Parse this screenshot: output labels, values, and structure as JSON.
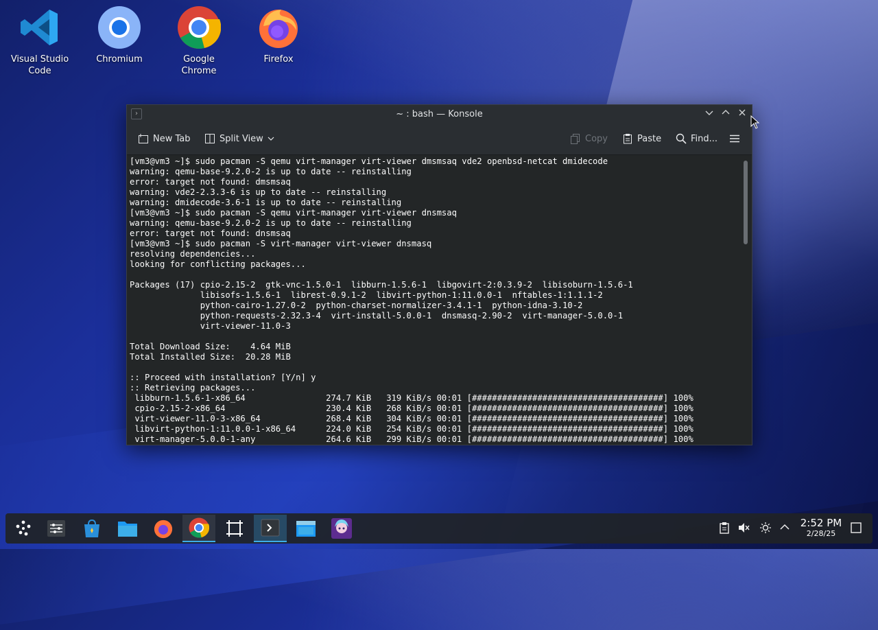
{
  "desktop": {
    "icons": [
      {
        "label": "Visual Studio Code"
      },
      {
        "label": "Chromium"
      },
      {
        "label": "Google Chrome"
      },
      {
        "label": "Firefox"
      }
    ]
  },
  "window": {
    "title": "~ : bash — Konsole",
    "toolbar": {
      "new_tab": "New Tab",
      "split_view": "Split View",
      "copy": "Copy",
      "paste": "Paste",
      "find": "Find..."
    },
    "terminal_lines": [
      "[vm3@vm3 ~]$ sudo pacman -S qemu virt-manager virt-viewer dmsmsaq vde2 openbsd-netcat dmidecode",
      "warning: qemu-base-9.2.0-2 is up to date -- reinstalling",
      "error: target not found: dmsmsaq",
      "warning: vde2-2.3.3-6 is up to date -- reinstalling",
      "warning: dmidecode-3.6-1 is up to date -- reinstalling",
      "[vm3@vm3 ~]$ sudo pacman -S qemu virt-manager virt-viewer dnsmsaq",
      "warning: qemu-base-9.2.0-2 is up to date -- reinstalling",
      "error: target not found: dnsmsaq",
      "[vm3@vm3 ~]$ sudo pacman -S virt-manager virt-viewer dnsmasq",
      "resolving dependencies...",
      "looking for conflicting packages...",
      "",
      "Packages (17) cpio-2.15-2  gtk-vnc-1.5.0-1  libburn-1.5.6-1  libgovirt-2:0.3.9-2  libisoburn-1.5.6-1",
      "              libisofs-1.5.6-1  librest-0.9.1-2  libvirt-python-1:11.0.0-1  nftables-1:1.1.1-2",
      "              python-cairo-1.27.0-2  python-charset-normalizer-3.4.1-1  python-idna-3.10-2",
      "              python-requests-2.32.3-4  virt-install-5.0.0-1  dnsmasq-2.90-2  virt-manager-5.0.0-1",
      "              virt-viewer-11.0-3",
      "",
      "Total Download Size:    4.64 MiB",
      "Total Installed Size:  20.28 MiB",
      "",
      ":: Proceed with installation? [Y/n] y",
      ":: Retrieving packages...",
      " libburn-1.5.6-1-x86_64                274.7 KiB   319 KiB/s 00:01 [######################################] 100%",
      " cpio-2.15-2-x86_64                    230.4 KiB   268 KiB/s 00:01 [######################################] 100%",
      " virt-viewer-11.0-3-x86_64             268.4 KiB   304 KiB/s 00:01 [######################################] 100%",
      " libvirt-python-1:11.0.0-1-x86_64      224.0 KiB   254 KiB/s 00:01 [######################################] 100%",
      " virt-manager-5.0.0-1-any              264.6 KiB   299 KiB/s 00:01 [######################################] 100%"
    ]
  },
  "taskbar": {
    "clock_time": "2:52 PM",
    "clock_date": "2/28/25",
    "items": [
      "launcher-icon",
      "system-settings-icon",
      "discover-store-icon",
      "file-manager-icon",
      "firefox-icon",
      "google-chrome-icon",
      "screenshot-tool-icon",
      "konsole-icon",
      "dolphin-icon",
      "avatar-app-icon"
    ]
  },
  "colors": {
    "accent": "#3daee9",
    "terminal_bg": "#232627"
  }
}
